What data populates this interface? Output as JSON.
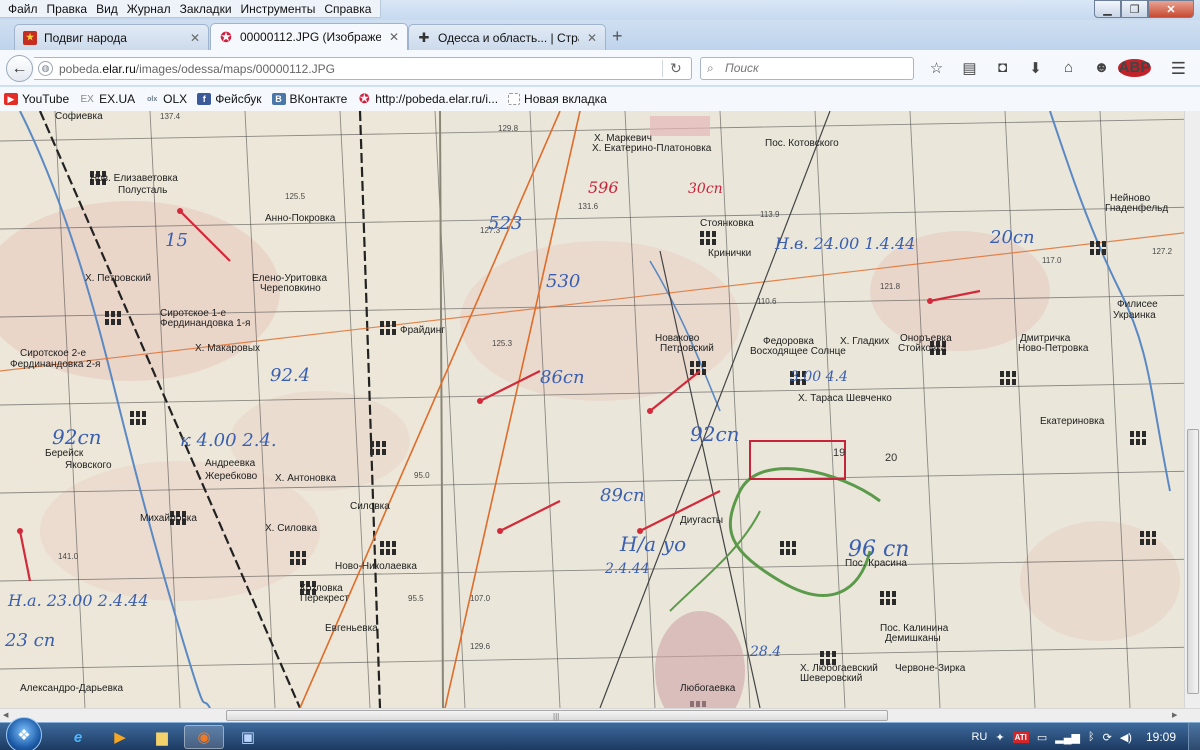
{
  "menu": [
    "Файл",
    "Правка",
    "Вид",
    "Журнал",
    "Закладки",
    "Инструменты",
    "Справка"
  ],
  "window_controls": {
    "minimize": "▁",
    "maximize": "❐",
    "close": "✕"
  },
  "tabs": [
    {
      "title": "Подвиг народа",
      "favicon": "red-star-flag-icon"
    },
    {
      "title": "00000112.JPG (Изображен...",
      "favicon": "star-icon"
    },
    {
      "title": "Одесса и область... | Стра...",
      "favicon": "cross-icon"
    }
  ],
  "tab_close_glyph": "✕",
  "new_tab_glyph": "+",
  "address": {
    "prefix": "pobeda.",
    "domain": "elar.ru",
    "path": "/images/odessa/maps/00000112.JPG"
  },
  "search": {
    "placeholder": "Поиск"
  },
  "toolbar_icons": [
    "star-bookmark-icon",
    "reader-list-icon",
    "pocket-icon",
    "download-icon",
    "home-icon",
    "chat-icon",
    "adblock-icon"
  ],
  "adblock_label": "ABP",
  "bookmarks": [
    {
      "label": "YouTube",
      "icon": "youtube-icon",
      "glyph": "▶"
    },
    {
      "label": "EX.UA",
      "icon": "exua-icon",
      "glyph": "EX"
    },
    {
      "label": "OLX",
      "icon": "olx-icon",
      "glyph": "olx"
    },
    {
      "label": "Фейсбук",
      "icon": "facebook-icon",
      "glyph": "f"
    },
    {
      "label": "ВКонтакте",
      "icon": "vk-icon",
      "glyph": "B"
    },
    {
      "label": "http://pobeda.elar.ru/i...",
      "icon": "star-icon",
      "glyph": "✪"
    },
    {
      "label": "Новая вкладка",
      "icon": "blank-page-icon",
      "glyph": ""
    }
  ],
  "map": {
    "places": [
      "Софиевка",
      "Нов. Елизаветовка",
      "Полусталь",
      "Анно-Покровка",
      "Елено-Уритовка",
      "Череповкино",
      "Х. Петровский",
      "Сиротское 1-е",
      "Фердинандовка 1-я",
      "Х. Макаровых",
      "Сиротское 2-е",
      "Фердинандовка 2-я",
      "Фрайдинг",
      "Андреевка",
      "Жеребково",
      "Х. Антоновка",
      "Берейск",
      "Яковского",
      "Михайловка",
      "Х. Силовка",
      "Силовка",
      "Ново-Николаевка",
      "Козловка",
      "Перекрест",
      "Евгеньевка",
      "Александро-Дарьевка",
      "Х. Маркевич",
      "Х. Екатерино-Платоновка",
      "Пос. Котовского",
      "Стоянковка",
      "Кринички",
      "Нейново",
      "Гнаденфельд",
      "Новаково",
      "Петровский",
      "Федоровка",
      "Восходящее Солнце",
      "Х. Гладких",
      "Оноръевка",
      "Стойковка",
      "Дмитричка",
      "Ново-Петровка",
      "Филисее",
      "Украинка",
      "Х. Тараса Шевченко",
      "Екатериновка",
      "Диугасты",
      "Пос. Красина",
      "Пос. Калинина",
      "Демишканы",
      "Х. Любогаевский",
      "Шеверовский",
      "Червоне-Зирка",
      "Любогаевка"
    ],
    "annotations": [
      "596",
      "523",
      "530",
      "30сп",
      "86сп",
      "92сп",
      "89сп",
      "20сп",
      "Н.в. 24.00 1.4.44",
      "к 4.00 2.4.",
      "92сп",
      "Н.а. 23.00 2.4.44",
      "23 сп",
      "Н/а уо",
      "2.4.44",
      "96 сп",
      "3.00 4.4",
      "28.4",
      "15",
      "92.4"
    ],
    "elevations": [
      "137.4",
      "125.5",
      "129.8",
      "127.3",
      "131.6",
      "121.8",
      "110.6",
      "125.3",
      "113.9",
      "95.0",
      "141.0",
      "107.0",
      "95.5",
      "129.6",
      "117.0",
      "127.2"
    ],
    "grid_labels": [
      "19",
      "20"
    ]
  },
  "taskbar": {
    "apps": [
      "start-orb-icon",
      "internet-explorer-icon",
      "media-player-icon",
      "file-explorer-icon",
      "firefox-icon",
      "save-disk-icon"
    ],
    "language": "RU",
    "ati_label": "ATI",
    "time": "19:09"
  }
}
